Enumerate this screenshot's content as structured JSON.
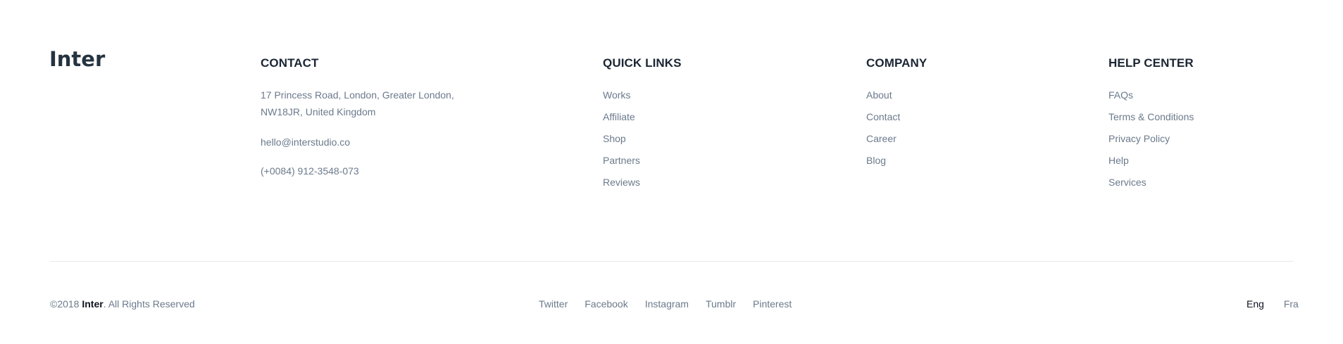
{
  "brand": {
    "logo_text": "Inter"
  },
  "contact": {
    "heading": "CONTACT",
    "address_line1": "17 Princess Road, London, Greater London,",
    "address_line2": "NW18JR, United Kingdom",
    "email": "hello@interstudio.co",
    "phone": "(+0084) 912-3548-073"
  },
  "quick_links": {
    "heading": "QUICK LINKS",
    "items": [
      {
        "label": "Works"
      },
      {
        "label": "Affiliate"
      },
      {
        "label": "Shop"
      },
      {
        "label": "Partners"
      },
      {
        "label": "Reviews"
      }
    ]
  },
  "company": {
    "heading": "COMPANY",
    "items": [
      {
        "label": "About"
      },
      {
        "label": "Contact"
      },
      {
        "label": "Career"
      },
      {
        "label": "Blog"
      }
    ]
  },
  "help_center": {
    "heading": "HELP CENTER",
    "items": [
      {
        "label": "FAQs"
      },
      {
        "label": "Terms & Conditions"
      },
      {
        "label": "Privacy Policy"
      },
      {
        "label": "Help"
      },
      {
        "label": "Services"
      }
    ]
  },
  "footer_bottom": {
    "copyright_prefix": "©2018 ",
    "copyright_brand": "Inter",
    "copyright_suffix": ". All Rights Reserved",
    "social": [
      {
        "label": "Twitter"
      },
      {
        "label": "Facebook"
      },
      {
        "label": "Instagram"
      },
      {
        "label": "Tumblr"
      },
      {
        "label": "Pinterest"
      }
    ],
    "languages": [
      {
        "label": "Eng",
        "active": true
      },
      {
        "label": "Fra",
        "active": false
      }
    ]
  },
  "colors": {
    "heading": "#1b2633",
    "link": "#6b7a8c",
    "divider": "#e6eaee",
    "active": "#0c1420"
  }
}
